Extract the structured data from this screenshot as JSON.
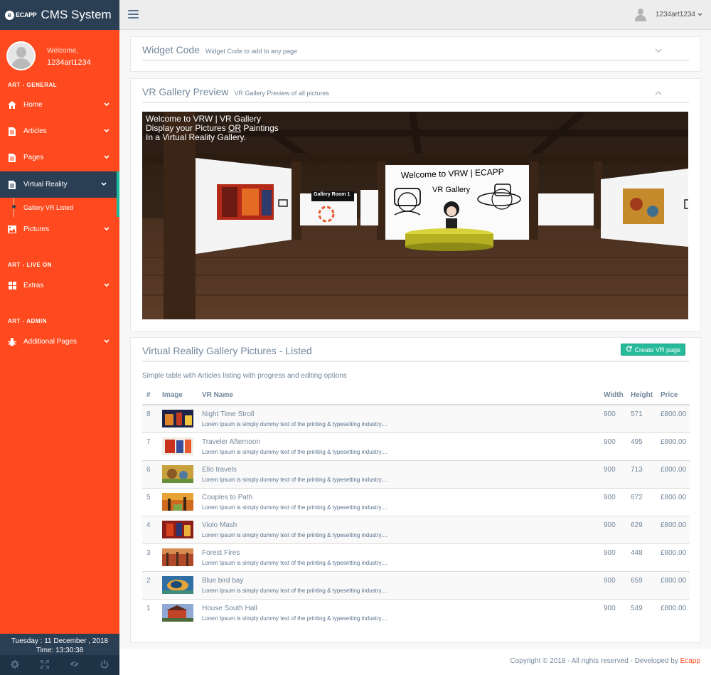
{
  "brand": {
    "logo_text": "ECAPP",
    "title": "CMS System"
  },
  "profile": {
    "welcome": "Welcome,",
    "username": "1234art1234"
  },
  "sidebar": {
    "sections": [
      "ART - GENERAL",
      "ART - LIVE ON",
      "ART - ADMIN"
    ],
    "items": [
      {
        "label": "Home",
        "icon": "home-icon"
      },
      {
        "label": "Articles",
        "icon": "file-icon"
      },
      {
        "label": "Pages",
        "icon": "file-icon"
      },
      {
        "label": "Virtual Reality",
        "icon": "file-icon",
        "active": true
      },
      {
        "label": "Pictures",
        "icon": "image-icon"
      },
      {
        "label": "Extras",
        "icon": "windows-icon"
      },
      {
        "label": "Additional Pages",
        "icon": "bug-icon"
      }
    ],
    "submenu": {
      "label": "Gallery VR Listed"
    },
    "date_line": "Tuesday : 11 December , 2018",
    "time_line": "Time: 13:30:38",
    "footer_icons": [
      "gear-icon",
      "fullscreen-icon",
      "eye-slash-icon",
      "power-icon"
    ]
  },
  "topbar": {
    "username": "1234art1234"
  },
  "widget_panel": {
    "title": "Widget Code",
    "subtitle": "Widget Code to add to any page"
  },
  "vr_panel": {
    "title": "VR Gallery Preview",
    "subtitle": "VR Gallery Preview of all pictures",
    "scene": {
      "line1": "Welcome to VRW | VR Gallery",
      "line2_prefix": "Display your Pictures ",
      "line2_underlined": "OR",
      "line2_suffix": " Paintings",
      "line3": "In a Virtual Reality Gallery.",
      "center_title": "Welcome to VRW | ECAPP",
      "center_sub": "VR Gallery",
      "room_label": "Gallery Room 1"
    }
  },
  "table_panel": {
    "title": "Virtual Reality Gallery Pictures - Listed",
    "button_label": "Create VR page",
    "subtitle": "Simple table with Articles listing with progress and editing options",
    "columns": [
      "#",
      "Image",
      "VR Name",
      "Width",
      "Height",
      "Price"
    ],
    "rows": [
      {
        "num": "8",
        "name": "Night Time Stroll",
        "desc": "Lorem Ipsum is simply dummy text of the printing & typesetting industry....",
        "width": "900",
        "height": "571",
        "price": "£800.00"
      },
      {
        "num": "7",
        "name": "Traveler Afternoon",
        "desc": "Lorem Ipsum is simply dummy text of the printing & typesetting industry....",
        "width": "900",
        "height": "495",
        "price": "£800.00"
      },
      {
        "num": "6",
        "name": "Elio travels",
        "desc": "Lorem Ipsum is simply dummy text of the printing & typesetting industry....",
        "width": "900",
        "height": "713",
        "price": "£800.00"
      },
      {
        "num": "5",
        "name": "Couples to Path",
        "desc": "Lorem Ipsum is simply dummy text of the printing & typesetting industry....",
        "width": "900",
        "height": "672",
        "price": "£800.00"
      },
      {
        "num": "4",
        "name": "Violo Mash",
        "desc": "Lorem Ipsum is simply dummy text of the printing & typesetting industry....",
        "width": "900",
        "height": "629",
        "price": "£800.00"
      },
      {
        "num": "3",
        "name": "Forest Fires",
        "desc": "Lorem Ipsum is simply dummy text of the printing & typesetting industry....",
        "width": "900",
        "height": "448",
        "price": "£800.00"
      },
      {
        "num": "2",
        "name": "Blue bird bay",
        "desc": "Lorem Ipsum is simply dummy text of the printing & typesetting industry....",
        "width": "900",
        "height": "659",
        "price": "£800.00"
      },
      {
        "num": "1",
        "name": "House South Hall",
        "desc": "Lorem Ipsum is simply dummy text of the printing & typesetting industry....",
        "width": "900",
        "height": "549",
        "price": "£800.00"
      }
    ]
  },
  "footer": {
    "copyright": "Copyright © 2018 - All rights reserved - Developed by ",
    "developer": "Ecapp"
  },
  "colors": {
    "sidebar": "#fe4a1e",
    "navy": "#2a3f54",
    "accent_green": "#26b99a",
    "text": "#73879c"
  }
}
